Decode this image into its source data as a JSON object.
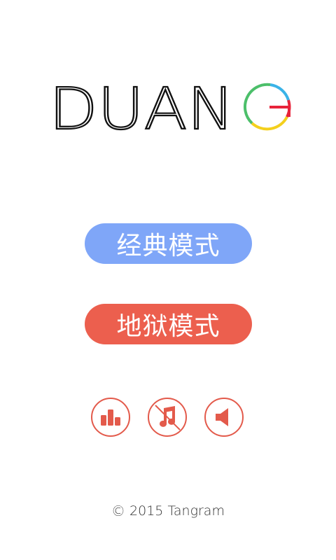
{
  "title": {
    "letters": [
      "D",
      "U",
      "A",
      "N"
    ],
    "last_letter": "G",
    "ring_colors": [
      "#3ab3e8",
      "#e8233a",
      "#f4d01d",
      "#4cbf6a"
    ]
  },
  "modes": {
    "classic_label": "经典模式",
    "hell_label": "地狱模式"
  },
  "controls": {
    "rank_icon": "rank-bars-icon",
    "music_icon": "music-off-icon",
    "sound_icon": "speaker-icon",
    "accent": "#e35a4b"
  },
  "footer": {
    "symbol": "©",
    "text": "2015 Tangram"
  },
  "colors": {
    "classic_button": "#7fa6f8",
    "hell_button": "#ec5f4e",
    "title_stroke": "#111111"
  }
}
